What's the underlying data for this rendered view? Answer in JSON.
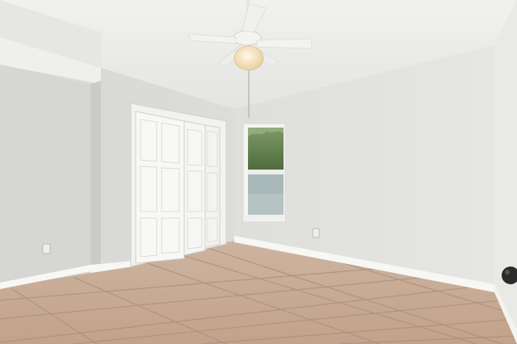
{
  "scene": {
    "watermark_text": "",
    "colors": {
      "ceiling": "#ececea",
      "wall_back": "#e3e3e0",
      "wall_left": "#d8d8d5",
      "wall_right": "#e8e8e5",
      "alcove": "#cfcfcc",
      "floor_tile": "#c7ab94",
      "grout": "#a88f7a",
      "baseboard": "#f7f7f5",
      "door": "#f8f8f6",
      "window_trees": "#5b7a48",
      "window_sky": "#b9c7c4",
      "window_glass_lower": "#a7b6b6",
      "fan_blade": "#f2f2f0",
      "light_globe": "#f3e3c4",
      "knob": "#2b2b2b"
    },
    "icons": [
      "ceiling-fan-icon",
      "light-globe-icon",
      "closet-door-icon",
      "window-icon",
      "outlet-icon",
      "door-knob-icon"
    ]
  }
}
